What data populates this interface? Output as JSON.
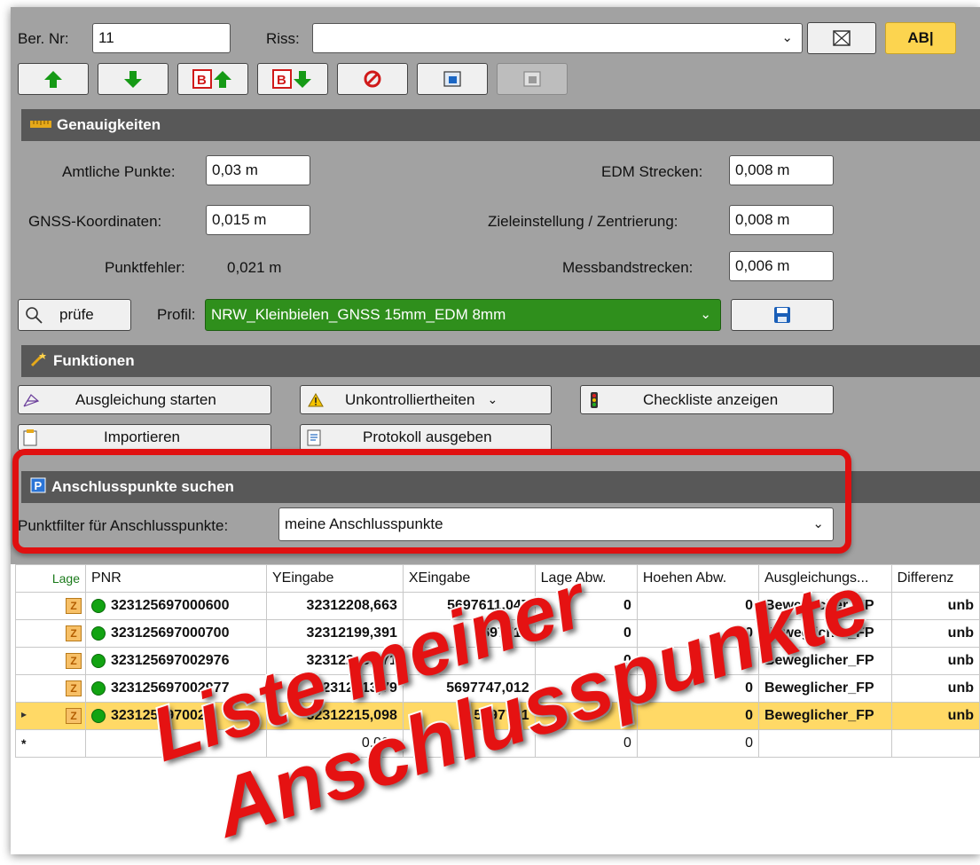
{
  "toolbar": {
    "ber_nr_label": "Ber. Nr:",
    "ber_nr_value": "11",
    "riss_label": "Riss:",
    "riss_value": "",
    "ab_label": "AB|"
  },
  "genauigkeiten": {
    "title": "Genauigkeiten",
    "amtliche_label": "Amtliche Punkte:",
    "amtliche_value": "0,03 m",
    "gnss_label": "GNSS-Koordinaten:",
    "gnss_value": "0,015 m",
    "punktfehler_label": "Punktfehler:",
    "punktfehler_value": "0,021 m",
    "edm_label": "EDM Strecken:",
    "edm_value": "0,008 m",
    "ziel_label": "Zieleinstellung / Zentrierung:",
    "ziel_value": "0,008 m",
    "messband_label": "Messbandstrecken:",
    "messband_value": "0,006 m",
    "pruefe_label": "prüfe",
    "profil_label": "Profil:",
    "profil_value": "NRW_Kleinbielen_GNSS 15mm_EDM 8mm"
  },
  "funktionen": {
    "title": "Funktionen",
    "ausgleichung_label": "Ausgleichung starten",
    "unkontrolliert_label": "Unkontrolliertheiten",
    "checkliste_label": "Checkliste anzeigen",
    "importieren_label": "Importieren",
    "protokoll_label": "Protokoll ausgeben"
  },
  "anschluss": {
    "title": "Anschlusspunkte suchen",
    "filter_label": "Punktfilter für Anschlusspunkte:",
    "filter_value": "meine Anschlusspunkte"
  },
  "table": {
    "headers": [
      "Lage",
      "PNR",
      "YEingabe",
      "XEingabe",
      "Lage Abw.",
      "Hoehen Abw.",
      "Ausgleichungs...",
      "Differenz"
    ],
    "rows": [
      {
        "pnr": "323125697000600",
        "y": "32312208,663",
        "x": "5697611,047",
        "lage": "0",
        "hoehe": "0",
        "ausg": "Beweglicher_FP",
        "diff": "unb"
      },
      {
        "pnr": "323125697000700",
        "y": "32312199,391",
        "x": "5697717",
        "lage": "0",
        "hoehe": "0",
        "ausg": "Beweglicher_FP",
        "diff": "unb"
      },
      {
        "pnr": "323125697002976",
        "y": "32312213,271",
        "x": "",
        "lage": "0",
        "hoehe": "0",
        "ausg": "Beweglicher_FP",
        "diff": "unb"
      },
      {
        "pnr": "323125697002977",
        "y": "32312213,79",
        "x": "5697747,012",
        "lage": "",
        "hoehe": "0",
        "ausg": "Beweglicher_FP",
        "diff": "unb"
      },
      {
        "pnr": "323125697002",
        "y": "32312215,098",
        "x": "5697751",
        "lage": "",
        "hoehe": "0",
        "ausg": "Beweglicher_FP",
        "diff": "unb"
      }
    ],
    "new_row": {
      "y": "0,000",
      "lage": "0",
      "hoehe": "0"
    },
    "row_marker": "▸",
    "new_marker": "*"
  },
  "overlay": {
    "line1": "Liste meiner",
    "line2": "Anschlusspunkte"
  },
  "colors": {
    "profile_green": "#2f8f1c",
    "highlight_red": "#e01010",
    "selected_row": "#ffd966",
    "section_header": "#585858"
  }
}
